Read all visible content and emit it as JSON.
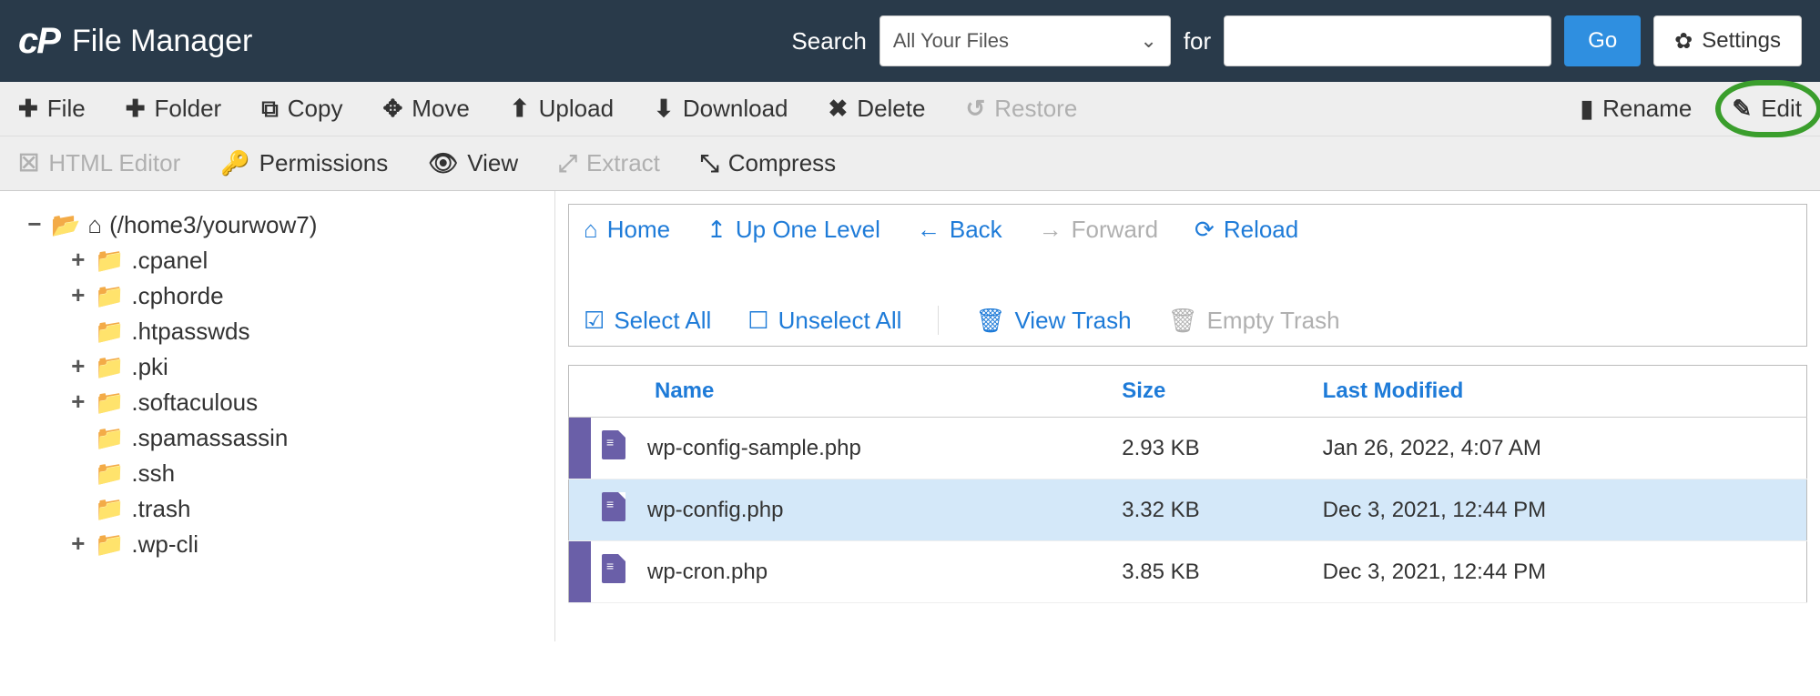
{
  "header": {
    "title": "File Manager",
    "search_label": "Search",
    "search_dropdown": "All Your Files",
    "for_label": "for",
    "search_value": "",
    "go_label": "Go",
    "settings_label": "Settings"
  },
  "toolbar1": {
    "file": "File",
    "folder": "Folder",
    "copy": "Copy",
    "move": "Move",
    "upload": "Upload",
    "download": "Download",
    "delete": "Delete",
    "restore": "Restore",
    "rename": "Rename",
    "edit": "Edit"
  },
  "toolbar2": {
    "html_editor": "HTML Editor",
    "permissions": "Permissions",
    "view": "View",
    "extract": "Extract",
    "compress": "Compress"
  },
  "tree": {
    "root": "(/home3/yourwow7)",
    "items": [
      {
        "name": ".cpanel",
        "expandable": true
      },
      {
        "name": ".cphorde",
        "expandable": true
      },
      {
        "name": ".htpasswds",
        "expandable": false
      },
      {
        "name": ".pki",
        "expandable": true
      },
      {
        "name": ".softaculous",
        "expandable": true
      },
      {
        "name": ".spamassassin",
        "expandable": false
      },
      {
        "name": ".ssh",
        "expandable": false
      },
      {
        "name": ".trash",
        "expandable": false
      },
      {
        "name": ".wp-cli",
        "expandable": true
      }
    ]
  },
  "nav": {
    "home": "Home",
    "up": "Up One Level",
    "back": "Back",
    "forward": "Forward",
    "reload": "Reload",
    "select_all": "Select All",
    "unselect_all": "Unselect All",
    "view_trash": "View Trash",
    "empty_trash": "Empty Trash"
  },
  "table": {
    "headers": {
      "name": "Name",
      "size": "Size",
      "modified": "Last Modified"
    },
    "rows": [
      {
        "name": "wp-config-sample.php",
        "size": "2.93 KB",
        "modified": "Jan 26, 2022, 4:07 AM",
        "selected": false
      },
      {
        "name": "wp-config.php",
        "size": "3.32 KB",
        "modified": "Dec 3, 2021, 12:44 PM",
        "selected": true
      },
      {
        "name": "wp-cron.php",
        "size": "3.85 KB",
        "modified": "Dec 3, 2021, 12:44 PM",
        "selected": false
      }
    ]
  }
}
